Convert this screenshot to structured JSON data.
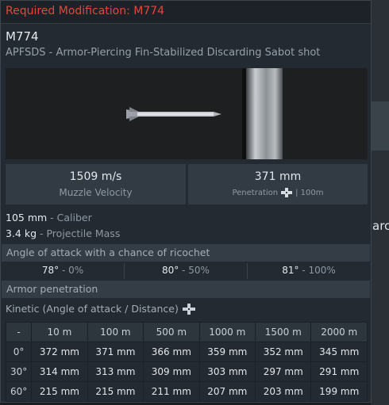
{
  "modification": {
    "required_text": "Required Modification: M774"
  },
  "shell": {
    "name": "M774",
    "type": "APFSDS - Armor-Piercing Fin-Stabilized Discarding Sabot shot"
  },
  "stats": {
    "velocity_value": "1509 m/s",
    "velocity_label": "Muzzle Velocity",
    "penetration_value": "371 mm",
    "penetration_label": "Penetration",
    "penetration_distance": "| 100m"
  },
  "properties": [
    {
      "value": "105 mm",
      "label": " - Caliber"
    },
    {
      "value": "3.4 kg",
      "label": " - Projectile Mass"
    }
  ],
  "ricochet": {
    "title": "Angle of attack with a chance of ricochet",
    "entries": [
      {
        "angle": "78°",
        "chance": " - 0%"
      },
      {
        "angle": "80°",
        "chance": " - 50%"
      },
      {
        "angle": "81°",
        "chance": " - 100%"
      }
    ]
  },
  "armor": {
    "title": "Armor penetration",
    "kinetic_label": "Kinetic (Angle of attack / Distance)",
    "columns": [
      "-",
      "10 m",
      "100 m",
      "500 m",
      "1000 m",
      "1500 m",
      "2000 m"
    ],
    "rows": [
      [
        "0°",
        "372 mm",
        "371 mm",
        "366 mm",
        "359 mm",
        "352 mm",
        "345 mm"
      ],
      [
        "30°",
        "314 mm",
        "313 mm",
        "309 mm",
        "303 mm",
        "297 mm",
        "291 mm"
      ],
      [
        "60°",
        "215 mm",
        "215 mm",
        "211 mm",
        "207 mm",
        "203 mm",
        "199 mm"
      ]
    ]
  },
  "background": {
    "fragment_text": "arch"
  },
  "colors": {
    "accent_red": "#e8453c",
    "panel": "#232a31",
    "header_row": "#343d46"
  }
}
